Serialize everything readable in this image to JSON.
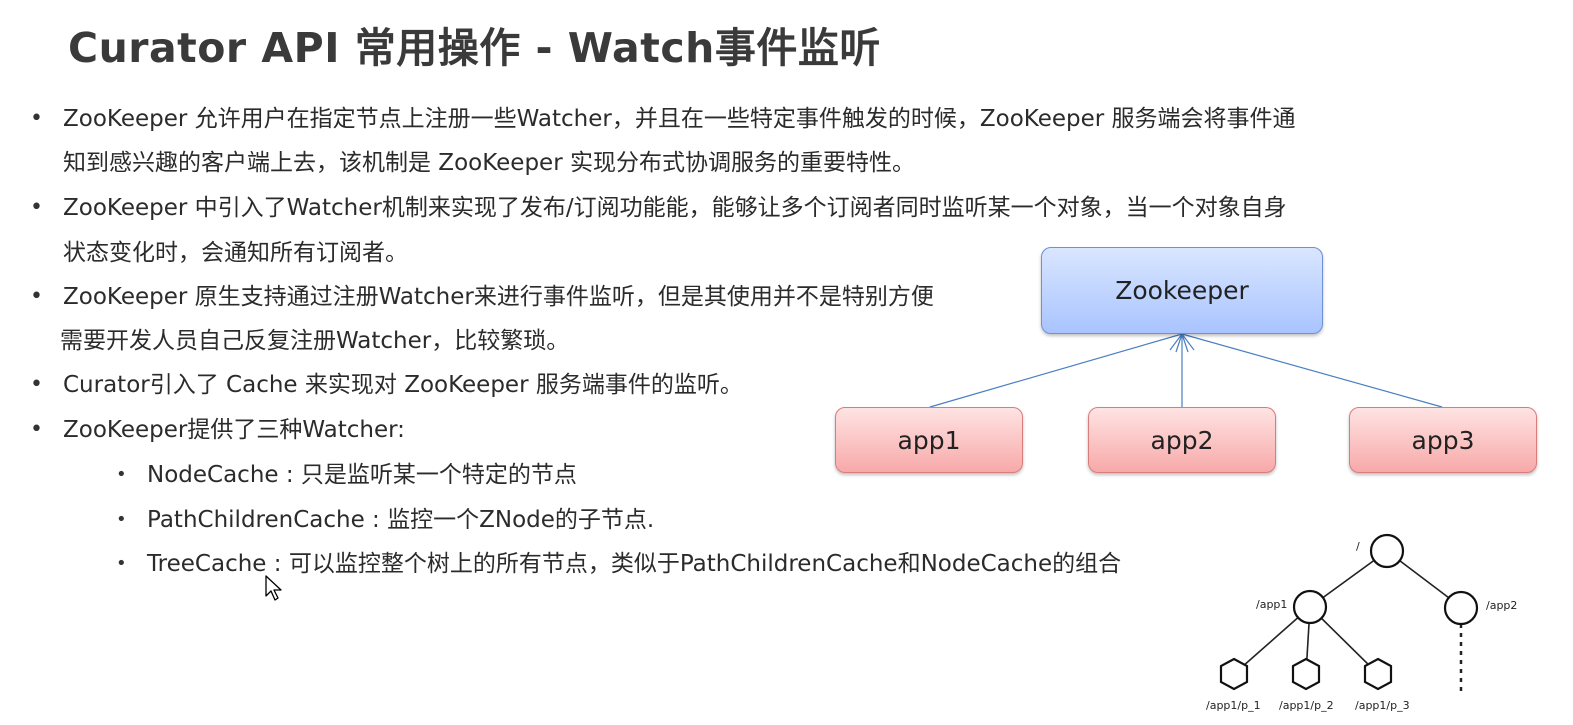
{
  "slide": {
    "title": "Curator API 常用操作 - Watch事件监听",
    "bullets": [
      {
        "lines": [
          "ZooKeeper 允许用户在指定节点上注册一些Watcher，并且在一些特定事件触发的时候，ZooKeeper 服务端会将事件通",
          "知到感兴趣的客户端上去，该机制是 ZooKeeper 实现分布式协调服务的重要特性。"
        ]
      },
      {
        "lines": [
          "ZooKeeper 中引入了Watcher机制来实现了发布/订阅功能能，能够让多个订阅者同时监听某一个对象，当一个对象自身",
          "状态变化时，会通知所有订阅者。"
        ]
      },
      {
        "lines": [
          "ZooKeeper 原生支持通过注册Watcher来进行事件监听，但是其使用并不是特别方便",
          "需要开发人员自己反复注册Watcher，比较繁琐。"
        ]
      },
      {
        "lines": [
          "Curator引入了 Cache 来实现对 ZooKeeper 服务端事件的监听。"
        ]
      },
      {
        "lines": [
          "ZooKeeper提供了三种Watcher:"
        ]
      }
    ],
    "sub_bullets": [
      "NodeCache : 只是监听某一个特定的节点",
      "PathChildrenCache : 监控一个ZNode的子节点.",
      "TreeCache : 可以监控整个树上的所有节点，类似于PathChildrenCache和NodeCache的组合"
    ]
  },
  "diagram": {
    "server": "Zookeeper",
    "clients": [
      "app1",
      "app2",
      "app3"
    ]
  },
  "tree": {
    "root": "/",
    "app1": "/app1",
    "app2": "/app2",
    "leaves": [
      "/app1/p_1",
      "/app1/p_2",
      "/app1/p_3"
    ]
  }
}
